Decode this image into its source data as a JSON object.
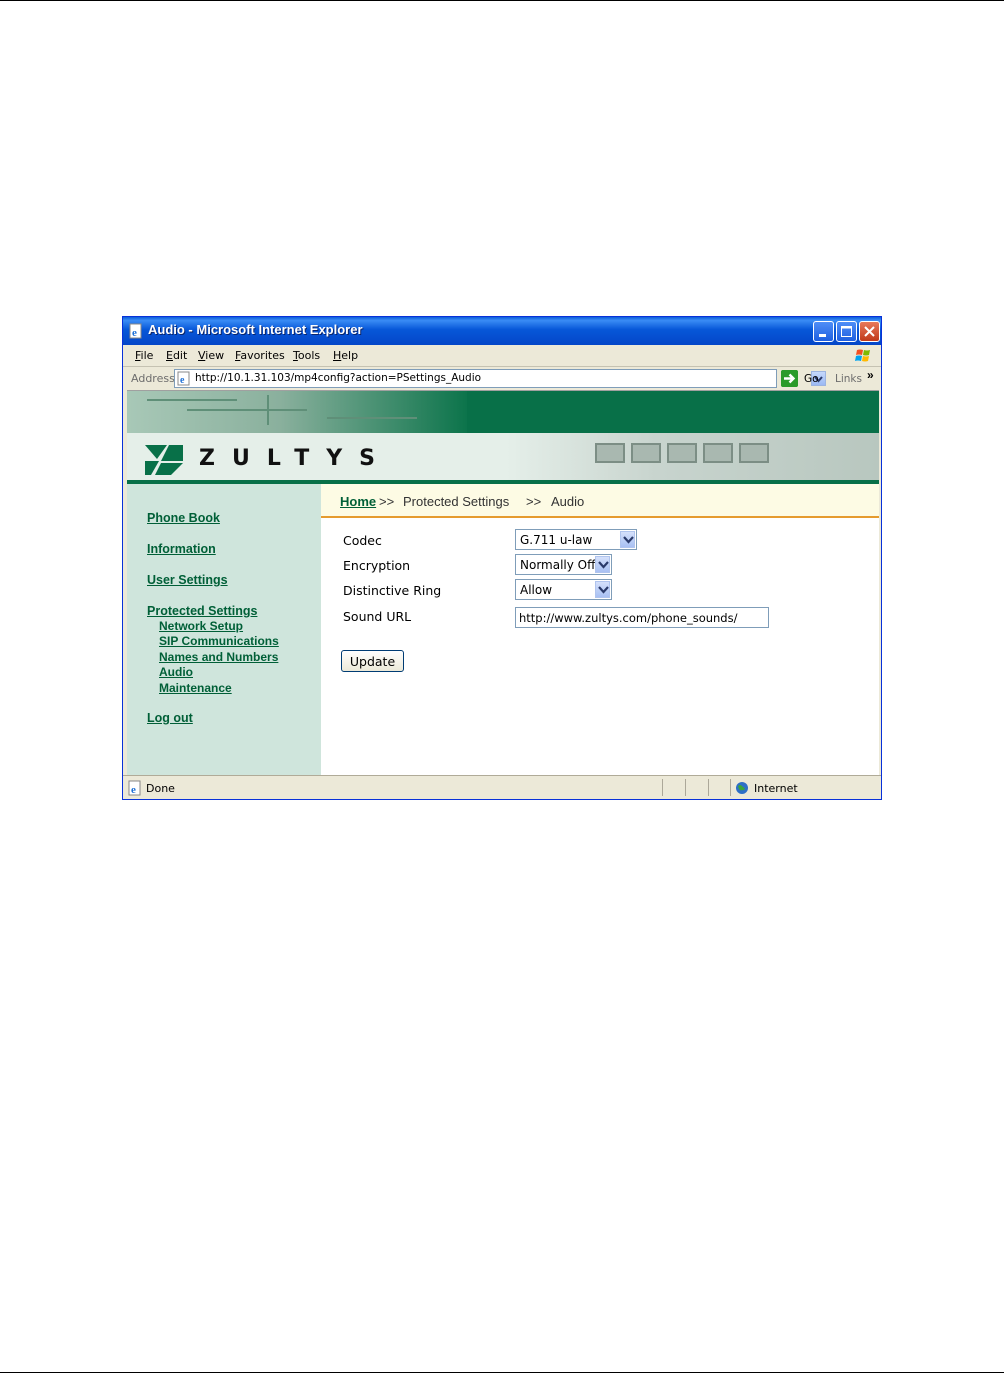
{
  "window": {
    "title": "Audio - Microsoft Internet Explorer",
    "menu": [
      "File",
      "Edit",
      "View",
      "Favorites",
      "Tools",
      "Help"
    ],
    "address_label": "Address",
    "url": "http://10.1.31.103/mp4config?action=PSettings_Audio",
    "go_label": "Go",
    "links_label": "Links",
    "links_chevron": "»"
  },
  "brand": {
    "logo_text": "ZULTYS",
    "accent": "#087048",
    "sidebar_bg": "#cfe5dc",
    "breadcrumb_rule": "#e59b2f"
  },
  "sidebar": {
    "phone_book": "Phone Book",
    "information": "Information",
    "user_settings": "User Settings",
    "protected_settings": "Protected Settings",
    "network_setup": "Network Setup",
    "sip_communications": "SIP Communications",
    "names_and_numbers": "Names and Numbers",
    "audio": "Audio",
    "maintenance": "Maintenance",
    "log_out": "Log out"
  },
  "breadcrumb": {
    "home": "Home",
    "sep": ">>",
    "protected": "Protected Settings",
    "current": "Audio"
  },
  "form": {
    "codec_label": "Codec",
    "codec_value": "G.711 u-law",
    "encryption_label": "Encryption",
    "encryption_value": "Normally Off",
    "ring_label": "Distinctive Ring",
    "ring_value": "Allow",
    "sound_url_label": "Sound URL",
    "sound_url_value": "http://www.zultys.com/phone_sounds/",
    "update_label": "Update"
  },
  "status": {
    "text": "Done",
    "zone": "Internet"
  },
  "icons": [
    "ie-page-icon",
    "minimize-icon",
    "maximize-icon",
    "close-icon",
    "windows-flag-icon",
    "go-arrow-icon",
    "dropdown-arrow-icon",
    "globe-icon",
    "zultys-logo-icon"
  ]
}
